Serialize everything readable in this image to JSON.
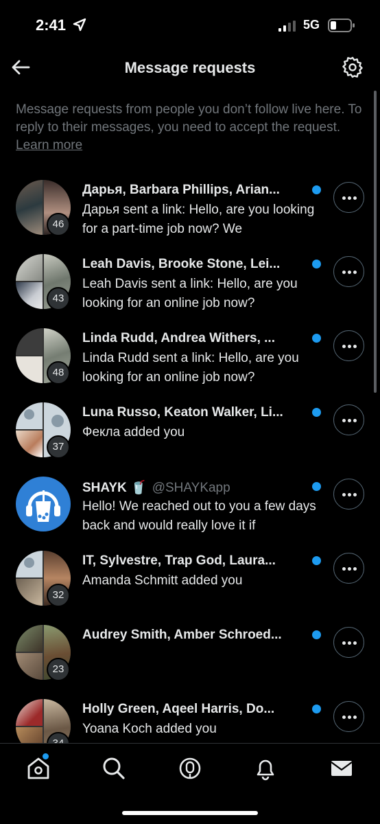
{
  "status_bar": {
    "time": "2:41",
    "network": "5G"
  },
  "header": {
    "title": "Message requests"
  },
  "intro": {
    "text": "Message requests from people you don’t follow live here. To reply to their messages, you need to accept the request.",
    "link": "Learn more"
  },
  "requests": [
    {
      "name": "Дарья, Barbara Phillips, Arian...",
      "handle": "",
      "preview": "Дарья sent a link: Hello, are you looking for a part-time job now? We",
      "count": "46",
      "unread": true
    },
    {
      "name": "Leah Davis, Brooke Stone, Lei...",
      "handle": "",
      "preview": "Leah Davis sent a link: Hello, are you looking for an online job now?",
      "count": "43",
      "unread": true
    },
    {
      "name": "Linda Rudd, Andrea Withers, ...",
      "handle": "",
      "preview": "Linda Rudd sent a link: Hello, are you looking for an online job now?",
      "count": "48",
      "unread": true
    },
    {
      "name": "Luna Russo, Keaton Walker, Li...",
      "handle": "",
      "preview": "Фекла added you",
      "count": "37",
      "unread": true
    },
    {
      "name": "SHAYK 🥤",
      "handle": "@SHAYKapp",
      "preview": "Hello! We reached out to you a few days back and would really love it if",
      "count": "",
      "unread": true
    },
    {
      "name": "IT, Sylvestre, Trap God, Laura...",
      "handle": "",
      "preview": "Amanda Schmitt added you",
      "count": "32",
      "unread": true
    },
    {
      "name": "Audrey Smith, Amber Schroed...",
      "handle": "",
      "preview": "",
      "count": "23",
      "unread": true
    },
    {
      "name": "Holly Green, Aqeel Harris, Do...",
      "handle": "",
      "preview": "Yoana Koch added you",
      "count": "34",
      "unread": true
    }
  ],
  "tabs": [
    "home",
    "search",
    "spaces",
    "notifications",
    "messages"
  ],
  "colors": {
    "accent": "#1d9bf0",
    "background": "#000000",
    "muted": "#71767b"
  }
}
